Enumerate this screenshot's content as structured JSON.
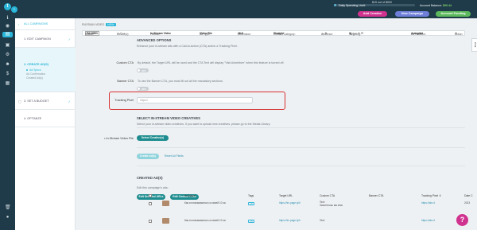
{
  "topbar": {
    "spending_limit_text": "$15 out of $500",
    "spending_limit_fraction": 0.03,
    "daily_label": "Daily Spending Limit:",
    "balance_label": "Account Balance:",
    "balance_value": "$99.44",
    "add_creative": "Add Creative",
    "new_campaign": "New Campaign",
    "account_funding": "Account Funding"
  },
  "rail": {
    "logo": "t",
    "toggle": "›",
    "icons": [
      {
        "name": "info-icon",
        "glyph": "ℹ"
      },
      {
        "name": "dashboard-icon",
        "glyph": "◉"
      },
      {
        "name": "campaigns-icon",
        "glyph": "▤",
        "active": true
      },
      {
        "name": "creatives-icon",
        "glyph": "▣"
      },
      {
        "name": "settings-icon",
        "glyph": "⚙"
      },
      {
        "name": "users-icon",
        "glyph": "☻"
      },
      {
        "name": "billing-icon",
        "glyph": "$"
      },
      {
        "name": "reports-icon",
        "glyph": "▦"
      },
      {
        "name": "trash-icon",
        "glyph": "🗑"
      },
      {
        "name": "profile-icon",
        "glyph": "●"
      }
    ]
  },
  "steps": {
    "all_campaigns": "ALL CAMPAIGNS",
    "s1": "1. EDIT CAMPAIGN",
    "s2": "2. CREATE AD(S)",
    "s2_sub": [
      "Ad Specs",
      "Ad Confirmation",
      "Created Ad(s)"
    ],
    "s3": "3. SET A BUDGET",
    "s4": "4. OPTIMIZE"
  },
  "main": {
    "preview_label": "RUSSIAN VIDEO",
    "preview_badge": "NEW",
    "info": {
      "status_label": "Status:",
      "status_value": "PAUSED",
      "devices_label": "Device(s):",
      "format_label": "Format:",
      "format_value": "In-Stream Video",
      "adtype_label": "Ad Type:",
      "adtype_value": "Video File",
      "dimension_label": "Dimension:",
      "dimension_value": "16:9",
      "category_label": "Content Category:",
      "category_value": "Straight",
      "audience_label": "Audience:",
      "targeting_label": "Targeting:",
      "rotation_label": "Ad Rotation:",
      "rotation_value": "Autopilot",
      "action_label": "Action:"
    },
    "advanced_title": "ADVANCED OPTIONS",
    "advanced_desc": "Enhance your in-stream ads with a Call-to-Action (CTA) and/or a Tracking Pixel.",
    "custom_cta_label": "Custom CTA",
    "custom_cta_desc": "By default, the Target URL will be used and the CTA Text will display \"Visit Advertiser\" when this feature is turned off.",
    "banner_cta_label": "Banner CTA",
    "banner_cta_desc": "To use the Banner CTA, you must fill out all the mandatory sections.",
    "toggle_off": "OFF",
    "tracking_pixel_label": "Tracking Pixel",
    "tracking_pixel_placeholder": "https://",
    "select_title": "SELECT IN-STREAM VIDEO CREATIVES",
    "select_desc": "Select your in-stream video creatives. If you want to upload new creatives, please go to the Media Library.",
    "video_file_label": "• In-Stream Video File",
    "select_creatives": "Select Creative(s)",
    "create_ads": "Create Ad(s)",
    "reset_fields": "Reset Ad Fields",
    "created_title": "CREATED AD(S)",
    "created_desc": "Edit this campaign's ads:",
    "edit_urls": "Edit Selected URLs",
    "edit_ctas": "Edit Custom CTAs"
  },
  "table": {
    "headers": [
      "Ad Name",
      "Tags",
      "Target URL",
      "Custom CTA",
      "Banner CTA",
      "Tracking Pixel ⇕",
      "Date C"
    ],
    "rows": [
      {
        "name": "Как я познакомился со своей 10 за",
        "tag": "+5",
        "url": "https://trc.page.ly/h",
        "cta": "Text:",
        "cta2": "Захотелось ма секс",
        "banner": "",
        "pixel": "https://abc.li",
        "date": "2023"
      },
      {
        "name": "Как я познакомился со своей 10 за",
        "tag": "+5",
        "url": "https://trc.page.ly/h",
        "cta": "Text:",
        "cta2": "",
        "banner": "",
        "pixel": "https://abc.li",
        "date": ""
      }
    ]
  },
  "chat_tab": "Chat",
  "help": "?"
}
